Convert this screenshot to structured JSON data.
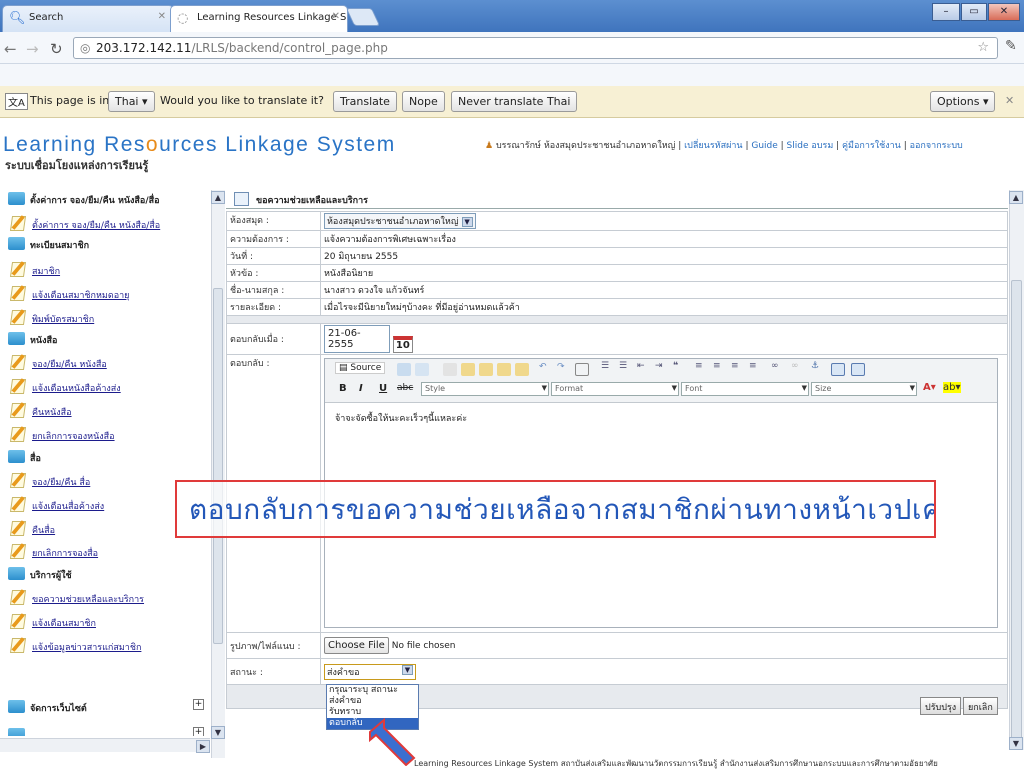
{
  "browser": {
    "tabs": [
      {
        "label": "Search"
      },
      {
        "label": "Learning Resources Linkage S"
      }
    ],
    "url_host": "203.172.142.11",
    "url_path": "/LRLS/backend/control_page.php"
  },
  "translate_bar": {
    "prefix": "This page is in",
    "language": "Thai",
    "question": "Would you like to translate it?",
    "translate": "Translate",
    "nope": "Nope",
    "never": "Never translate Thai",
    "options": "Options"
  },
  "header": {
    "title_part1": "Learning Res",
    "title_o": "o",
    "title_part2": "urces Linkage System",
    "subtitle": "ระบบเชื่อมโยงแหล่งการเรียนรู้",
    "user": "บรรณารักษ์ ห้องสมุดประชาชนอำเภอหาดใหญ่",
    "links": [
      "เปลี่ยนรหัสผ่าน",
      "Guide",
      "Slide อบรม",
      "คู่มือการใช้งาน",
      "ออกจากระบบ"
    ]
  },
  "sidebar": {
    "rows": [
      {
        "type": "folder",
        "label": "ตั้งค่าการ จอง/ยืม/คืน หนังสือ/สื่อ"
      },
      {
        "type": "item",
        "label": "ตั้งค่าการ จอง/ยืม/คืน หนังสือ/สื่อ"
      },
      {
        "type": "folder",
        "label": "ทะเบียนสมาชิก"
      },
      {
        "type": "item",
        "label": "สมาชิก"
      },
      {
        "type": "item",
        "label": "แจ้งเตือนสมาชิกหมดอายุ"
      },
      {
        "type": "item",
        "label": "พิมพ์บัตรสมาชิก"
      },
      {
        "type": "folder",
        "label": "หนังสือ"
      },
      {
        "type": "item",
        "label": "จอง/ยืม/คืน หนังสือ"
      },
      {
        "type": "item",
        "label": "แจ้งเตือนหนังสือค้างส่ง"
      },
      {
        "type": "item",
        "label": "คืนหนังสือ"
      },
      {
        "type": "item",
        "label": "ยกเลิกการจองหนังสือ"
      },
      {
        "type": "folder",
        "label": "สื่อ"
      },
      {
        "type": "item",
        "label": "จอง/ยืม/คืน สื่อ"
      },
      {
        "type": "item",
        "label": "แจ้งเตือนสื่อค้างส่ง"
      },
      {
        "type": "item",
        "label": "คืนสื่อ"
      },
      {
        "type": "item",
        "label": "ยกเลิกการจองสื่อ"
      },
      {
        "type": "folder",
        "label": "บริการผู้ใช้"
      },
      {
        "type": "item",
        "label": "ขอความช่วยเหลือและบริการ"
      },
      {
        "type": "item",
        "label": "แจ้งเตือนสมาชิก"
      },
      {
        "type": "item",
        "label": "แจ้งข้อมูลข่าวสารแก่สมาชิก"
      }
    ],
    "bottom": [
      "จัดการเว็บไซต์"
    ]
  },
  "form": {
    "title": "ขอความช่วยเหลือและบริการ",
    "rows": [
      {
        "label": "ห้องสมุด :",
        "value": "ห้องสมุดประชาชนอำเภอหาดใหญ่"
      },
      {
        "label": "ความต้องการ :",
        "value": "แจ้งความต้องการพิเศษเฉพาะเรื่อง"
      },
      {
        "label": "วันที่ :",
        "value": "20 มิถุนายน 2555"
      },
      {
        "label": "หัวข้อ :",
        "value": "หนังสือนิยาย"
      },
      {
        "label": "ชื่อ-นามสกุล :",
        "value": "นางสาว ดวงใจ แก้วจันทร์"
      },
      {
        "label": "รายละเอียด :",
        "value": "เมื่อไรจะมีนิยายใหม่ๆบ้างคะ ที่มีอยู่อ่านหมดแล้วค้า"
      }
    ],
    "reply_date_label": "ตอบกลับเมื่อ :",
    "reply_date": "21-06-2555",
    "calendar_day": "10",
    "reply_label": "ตอบกลับ :",
    "editor": {
      "source": "Source",
      "style": "Style",
      "format": "Format",
      "font": "Font",
      "size": "Size",
      "content": "จ้าจะจัดซื้อให้นะคะเร็วๆนี้แหละค่ะ"
    },
    "attach_label": "รูปภาพ/ไฟล์แนบ :",
    "choose_file": "Choose File",
    "no_file": "No file chosen",
    "status_label": "สถานะ :",
    "status_value": "ส่งคำขอ",
    "status_options": [
      "กรุณาระบุ สถานะ",
      "ส่งคำขอ",
      "รับทราบ",
      "ตอบกลับ"
    ],
    "update": "ปรับปรุง",
    "cancel": "ยกเลิก"
  },
  "overlay_text": "ตอบกลับการขอความช่วยเหลือจากสมาชิกผ่านทางหน้าเวปเครือข่าย",
  "footer": "Learning Resources Linkage System สถาบันส่งเสริมและพัฒนานวัตกรรมการเรียนรู้ สำนักงานส่งเสริมการศึกษานอกระบบและการศึกษาตามอัธยาศัย",
  "colors": {
    "accent": "#2a74c6",
    "overlay_border": "#e03a3a",
    "overlay_text": "#2357b8",
    "arrow": "#3b6fd0"
  }
}
